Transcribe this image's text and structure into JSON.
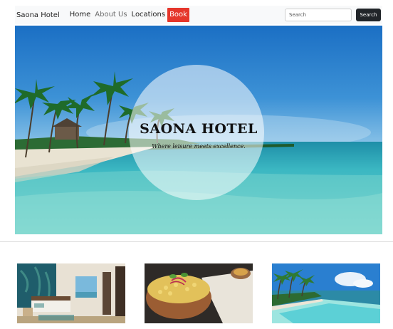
{
  "navbar": {
    "brand": "Saona Hotel",
    "links": [
      {
        "label": "Home",
        "state": "default"
      },
      {
        "label": "About Us",
        "state": "muted"
      },
      {
        "label": "Locations",
        "state": "default"
      },
      {
        "label": "Book",
        "state": "active"
      }
    ],
    "search": {
      "placeholder": "Search",
      "value": "",
      "button_label": "Search"
    }
  },
  "hero": {
    "title": "SAONA HOTEL",
    "tagline": "Where leisure meets excellence."
  },
  "cards": [
    {
      "image": "hotel-room-photo"
    },
    {
      "image": "food-bowl-photo"
    },
    {
      "image": "beach-pool-photo"
    }
  ],
  "colors": {
    "navbar_bg": "#f8f9fa",
    "book_active": "#e5362b",
    "search_button": "#212529"
  }
}
